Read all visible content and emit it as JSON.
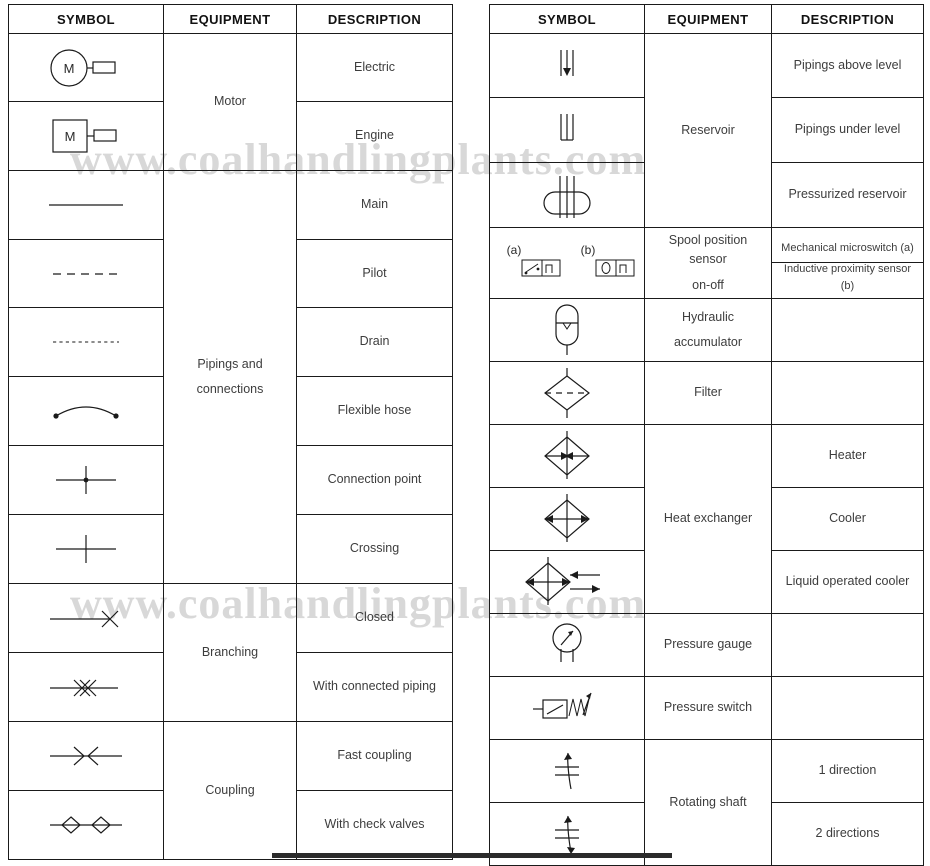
{
  "watermark": {
    "text": "www.coalhandlingplants.com",
    "color": "#d8d8d8"
  },
  "tables": {
    "left": {
      "headers": [
        "SYMBOL",
        "EQUIPMENT",
        "DESCRIPTION"
      ],
      "rows": [
        {
          "symbol": "electric-motor-circle-m",
          "equipment": "Motor",
          "description": "Electric"
        },
        {
          "symbol": "engine-square-m",
          "equipment": "",
          "description": "Engine"
        },
        {
          "symbol": "solid-line",
          "equipment": "Pipings and connections",
          "description": "Main"
        },
        {
          "symbol": "dashed-line",
          "equipment": "",
          "description": "Pilot"
        },
        {
          "symbol": "dotted-line",
          "equipment": "",
          "description": "Drain"
        },
        {
          "symbol": "arc-flexible-hose",
          "equipment": "",
          "description": "Flexible hose"
        },
        {
          "symbol": "cross-with-dot",
          "equipment": "",
          "description": "Connection point"
        },
        {
          "symbol": "plain-cross",
          "equipment": "",
          "description": "Crossing"
        },
        {
          "symbol": "line-with-x-end",
          "equipment": "Branching",
          "description": "Closed"
        },
        {
          "symbol": "line-with-double-x",
          "equipment": "",
          "description": "With connected piping"
        },
        {
          "symbol": "fast-coupling-arrows",
          "equipment": "Coupling",
          "description": "Fast coupling"
        },
        {
          "symbol": "coupling-check-valves",
          "equipment": "",
          "description": "With check valves"
        }
      ],
      "equipment_spans": {
        "Motor": 2,
        "Pipings and connections": 6,
        "Branching": 2,
        "Coupling": 2
      },
      "equipment_labels": {
        "motor": "Motor",
        "pipings_line1": "Pipings and",
        "pipings_line2": "connections",
        "branching": "Branching",
        "coupling": "Coupling"
      }
    },
    "right": {
      "headers": [
        "SYMBOL",
        "EQUIPMENT",
        "DESCRIPTION"
      ],
      "rows": [
        {
          "symbol": "reservoir-pipe-above",
          "equipment": "Reservoir",
          "description": "Pipings above level"
        },
        {
          "symbol": "reservoir-pipe-under",
          "equipment": "",
          "description": "Pipings under level"
        },
        {
          "symbol": "pressurized-reservoir",
          "equipment": "",
          "description": "Pressurized reservoir"
        },
        {
          "symbol": "spool-position-sensors",
          "equipment": "Spool position sensor on-off",
          "description_a": "Mechanical microswitch (a)",
          "description_b": "Inductive proximity sensor (b)"
        },
        {
          "symbol": "hydraulic-accumulator",
          "equipment": "Hydraulic accumulator",
          "description": ""
        },
        {
          "symbol": "filter-diamond",
          "equipment": "Filter",
          "description": ""
        },
        {
          "symbol": "heater-diamond",
          "equipment": "Heat exchanger",
          "description": "Heater"
        },
        {
          "symbol": "cooler-diamond",
          "equipment": "",
          "description": "Cooler"
        },
        {
          "symbol": "liquid-operated-cooler-diamond",
          "equipment": "",
          "description": "Liquid operated cooler"
        },
        {
          "symbol": "pressure-gauge",
          "equipment": "Pressure gauge",
          "description": ""
        },
        {
          "symbol": "pressure-switch",
          "equipment": "Pressure switch",
          "description": ""
        },
        {
          "symbol": "rotating-shaft-1dir",
          "equipment": "Rotating shaft",
          "description": "1 direction"
        },
        {
          "symbol": "rotating-shaft-2dir",
          "equipment": "",
          "description": "2 directions"
        }
      ],
      "equipment_labels": {
        "reservoir": "Reservoir",
        "spool_line1": "Spool position sensor",
        "spool_line2": "on-off",
        "accumulator_line1": "Hydraulic",
        "accumulator_line2": "accumulator",
        "filter": "Filter",
        "heat_exchanger": "Heat exchanger",
        "pressure_gauge": "Pressure gauge",
        "pressure_switch": "Pressure switch",
        "rotating_shaft": "Rotating shaft"
      },
      "symbol_annotations": {
        "spool_a": "(a)",
        "spool_b": "(b)"
      }
    }
  }
}
